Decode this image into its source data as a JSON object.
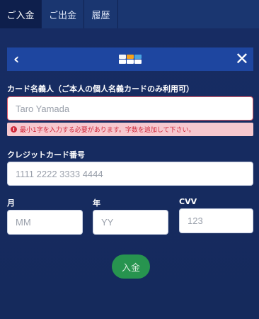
{
  "tabs": [
    {
      "label": "ご入金"
    },
    {
      "label": "ご出金"
    },
    {
      "label": "履歴"
    }
  ],
  "header": {
    "back_icon": "‹",
    "close_icon": "✕",
    "card_brand_colors": [
      "#d8232a",
      "#f7a21b",
      "#4aa3df",
      "#f4f4f4",
      "#ffffff",
      "#ffffff"
    ]
  },
  "form": {
    "name_label": "カード名義人（ご本人の個人名義カードのみ利用可）",
    "name_placeholder": "Taro Yamada",
    "name_error": "最小1字を入力する必要があります。字数を追加して下さい。",
    "error_icon": "!",
    "card_number_label": "クレジットカード番号",
    "card_number_placeholder": "1111 2222 3333 4444",
    "month_label": "月",
    "month_placeholder": "MM",
    "year_label": "年",
    "year_placeholder": "YY",
    "cvv_label": "CVV",
    "cvv_placeholder": "123",
    "submit_label": "入金"
  },
  "colors": {
    "background": "#16295a",
    "header_bar": "#1e46a0",
    "submit": "#27944f",
    "error": "#d0283b"
  }
}
